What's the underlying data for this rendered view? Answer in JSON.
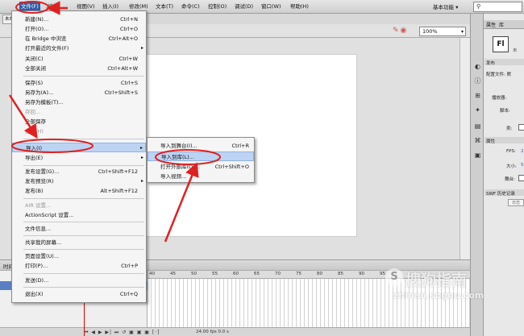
{
  "menubar": {
    "items": [
      "文件(F)",
      "编辑",
      "视图(V)",
      "插入(I)",
      "修改(M)",
      "文本(T)",
      "命令(C)",
      "控制(O)",
      "调试(D)",
      "窗口(W)",
      "帮助(H)"
    ],
    "workspace": "基本功能 ▾",
    "search_icon": "search-icon"
  },
  "document_tab": "未命名",
  "edit_bar": {
    "zoom": "100%"
  },
  "file_menu": {
    "items": [
      {
        "label": "新建(N)...",
        "shortcut": "Ctrl+N"
      },
      {
        "label": "打开(O)...",
        "shortcut": "Ctrl+O"
      },
      {
        "label": "在 Bridge 中浏览",
        "shortcut": "Ctrl+Alt+O"
      },
      {
        "label": "打开最近的文件(F)",
        "shortcut": ""
      },
      {
        "label": "关闭(C)",
        "shortcut": "Ctrl+W"
      },
      {
        "label": "全部关闭",
        "shortcut": "Ctrl+Alt+W"
      },
      {
        "label": "保存(S)",
        "shortcut": "Ctrl+S"
      },
      {
        "label": "另存为(A)...",
        "shortcut": "Ctrl+Shift+S"
      },
      {
        "label": "另存为模板(T)...",
        "shortcut": ""
      },
      {
        "label": "存回...",
        "shortcut": ""
      },
      {
        "label": "全部保存",
        "shortcut": ""
      },
      {
        "label": "还原(H)",
        "shortcut": ""
      },
      {
        "label": "导入(I)",
        "shortcut": ""
      },
      {
        "label": "导出(E)",
        "shortcut": ""
      },
      {
        "label": "发布设置(G)...",
        "shortcut": "Ctrl+Shift+F12"
      },
      {
        "label": "发布预览(R)",
        "shortcut": ""
      },
      {
        "label": "发布(B)",
        "shortcut": "Alt+Shift+F12"
      },
      {
        "label": "AIR 设置...",
        "shortcut": ""
      },
      {
        "label": "ActionScript 设置...",
        "shortcut": ""
      },
      {
        "label": "文件信息...",
        "shortcut": ""
      },
      {
        "label": "共享我的屏幕...",
        "shortcut": ""
      },
      {
        "label": "页面设置(U)...",
        "shortcut": ""
      },
      {
        "label": "打印(P)...",
        "shortcut": "Ctrl+P"
      },
      {
        "label": "发送(D)...",
        "shortcut": ""
      },
      {
        "label": "退出(X)",
        "shortcut": "Ctrl+Q"
      }
    ]
  },
  "import_submenu": {
    "items": [
      {
        "label": "导入到舞台(I)...",
        "shortcut": "Ctrl+R"
      },
      {
        "label": "导入到库(L)...",
        "shortcut": ""
      },
      {
        "label": "打开外部库(O)...",
        "shortcut": "Ctrl+Shift+O"
      },
      {
        "label": "导入视频...",
        "shortcut": ""
      }
    ]
  },
  "timeline": {
    "label": "时间轴",
    "ticks": [
      "40",
      "45",
      "50",
      "55",
      "60",
      "65",
      "70",
      "75",
      "80",
      "85",
      "90",
      "95"
    ],
    "controls": "⏮ ◀ ▶ ▶| ⏭  ↺ ▣ ▣ ▣ [·]",
    "fps": "24.00 fps   0.0 s"
  },
  "properties": {
    "tab_props": "属性",
    "tab_lib": "库",
    "doc_type": "Fl",
    "doc_sub": "未",
    "sec_publish": "发布",
    "profile_label": "配置文件: 默",
    "player_label": "播放器:",
    "script_label": "脚本:",
    "class_label": "类:",
    "sec_attr": "属性",
    "fps_label": "FPS:",
    "fps_val": "2",
    "size_label": "大小:",
    "size_val": "5",
    "stage_label": "舞台:",
    "sec_swf": "SWF 历史记录",
    "swf_btn": "日志"
  },
  "watermark": {
    "logo": "S",
    "text": "搜狗指南",
    "url": "zhinan.sogou.com"
  },
  "annotation_color": "#e02020"
}
